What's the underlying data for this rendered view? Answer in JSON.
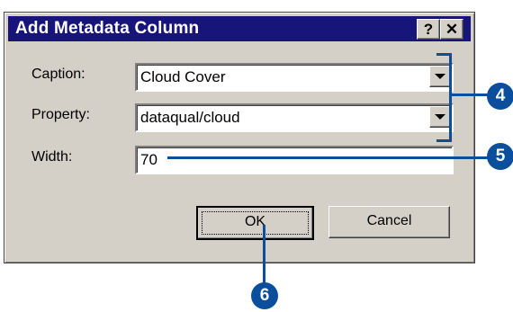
{
  "dialog": {
    "title": "Add Metadata Column",
    "help_glyph": "?",
    "close_glyph": "✕"
  },
  "fields": {
    "caption": {
      "label": "Caption:",
      "value": "Cloud Cover"
    },
    "property": {
      "label": "Property:",
      "value": "dataqual/cloud"
    },
    "width": {
      "label": "Width:",
      "value": "70"
    }
  },
  "buttons": {
    "ok": "OK",
    "cancel": "Cancel"
  },
  "callouts": {
    "step4": "4",
    "step5": "5",
    "step6": "6",
    "color": "#0b4f9c"
  },
  "icons": [
    "help-icon",
    "close-icon",
    "dropdown-arrow-icon"
  ]
}
